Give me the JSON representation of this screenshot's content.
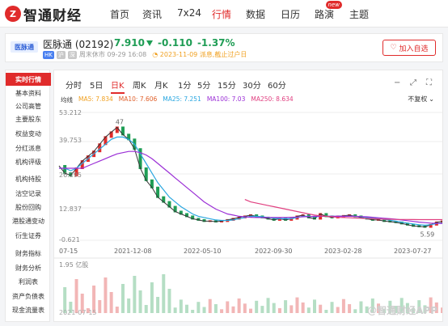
{
  "nav": {
    "logo_mark": "Z",
    "logo_text": "智通财经",
    "items": [
      {
        "label": "首页"
      },
      {
        "label": "资讯"
      },
      {
        "label": "7x24"
      },
      {
        "label": "行情"
      },
      {
        "label": "数据"
      },
      {
        "label": "日历"
      },
      {
        "label": "路演"
      },
      {
        "label": "主题"
      }
    ],
    "new_badge": "new",
    "active": "行情"
  },
  "stock": {
    "logo_text": "医脉通",
    "name": "医脉通 (02192)",
    "price": "7.910",
    "change": "-0.110",
    "change_pct": "-1.37%",
    "market_tag": "HK",
    "tag2": "沪",
    "tag3": "深",
    "status": "周末休市 09-29 16:08",
    "event": "2023-11-09 派息,截止过户日",
    "follow_label": "加入自选"
  },
  "sidebar": {
    "items": [
      {
        "label": "实时行情"
      },
      {
        "label": "基本资料"
      },
      {
        "label": "公司高管"
      },
      {
        "label": "主要股东"
      },
      {
        "label": "权益变动"
      },
      {
        "label": "分红派息"
      },
      {
        "label": "机构评级"
      },
      {
        "label": "机构持股"
      },
      {
        "label": "沽空记录"
      },
      {
        "label": "股份回购"
      },
      {
        "label": "港股通变动"
      },
      {
        "label": "衍生证券"
      },
      {
        "label": "财务指标"
      },
      {
        "label": "财务分析"
      },
      {
        "label": "利润表"
      },
      {
        "label": "资产负债表"
      },
      {
        "label": "现金流量表"
      }
    ]
  },
  "chart": {
    "tabs": [
      {
        "label": "分时"
      },
      {
        "label": "5日"
      },
      {
        "label": "日K"
      },
      {
        "label": "周K"
      },
      {
        "label": "月K"
      },
      {
        "label": "1分"
      },
      {
        "label": "5分"
      },
      {
        "label": "15分"
      },
      {
        "label": "30分"
      },
      {
        "label": "60分"
      }
    ],
    "active_tab": "日K",
    "ma_prefix": "均线",
    "ma": [
      {
        "label": "MA5: 7.834",
        "color": "#f0a020"
      },
      {
        "label": "MA10: 7.606",
        "color": "#e0602b"
      },
      {
        "label": "MA25: 7.251",
        "color": "#2aa7e0"
      },
      {
        "label": "MA100: 7.03",
        "color": "#9b2fd6"
      },
      {
        "label": "MA250: 8.634",
        "color": "#e04080"
      }
    ],
    "adjust_label": "不复权",
    "y_ticks": [
      "53.212",
      "39.753",
      "26.295",
      "12.837",
      "-0.621"
    ],
    "x_ticks": [
      "07-15",
      "2021-12-08",
      "2022-05-10",
      "2022-09-30",
      "2023-02-28",
      "2023-07-27"
    ],
    "high_marker": "47",
    "low_marker": "5.59",
    "volume_label": "1.95 亿股",
    "bottom_date": "2021-07-15",
    "watermark": "@智通财经APP"
  },
  "chart_data": {
    "type": "line",
    "title": "",
    "ylim": [
      -0.621,
      53.212
    ],
    "x_ticks": [
      "07-15",
      "2021-12-08",
      "2022-05-10",
      "2022-09-30",
      "2023-02-28",
      "2023-07-27"
    ],
    "series": [
      {
        "name": "",
        "color": "#333333",
        "values": [
          31,
          28,
          27,
          30,
          33,
          35,
          37,
          40,
          43,
          45,
          47,
          44,
          42,
          38,
          30,
          25,
          22,
          18,
          16,
          14,
          12,
          11,
          10,
          9,
          8.5,
          8,
          8,
          7.8,
          8,
          8.5,
          9,
          9.5,
          10,
          10.5,
          10,
          9.5,
          9,
          8.5,
          9,
          8.5,
          9,
          10,
          10.5,
          9.5,
          9,
          11,
          10,
          9.5,
          10,
          10.2,
          10.5,
          10,
          9.5,
          9,
          8.5,
          8.5,
          8,
          7.8,
          7.5,
          7,
          6.5,
          6,
          5.8,
          5.59,
          6.5,
          7.5,
          7.91
        ]
      },
      {
        "name": "MA25",
        "color": "#2aa7e0",
        "values": [
          30,
          30,
          29,
          30,
          32,
          34,
          36,
          38,
          40,
          42,
          43,
          43,
          42,
          40,
          36,
          32,
          28,
          24,
          21,
          18,
          16,
          14,
          12.5,
          11,
          10,
          9.5,
          9,
          8.5,
          8.3,
          8.3,
          8.5,
          9,
          9.5,
          10,
          10,
          9.8,
          9.5,
          9.2,
          9,
          9,
          9,
          9.5,
          10,
          10,
          9.8,
          10,
          10,
          10,
          10,
          10,
          10,
          10,
          9.8,
          9.5,
          9.2,
          9,
          8.7,
          8.4,
          8,
          7.6,
          7.2,
          6.8,
          6.5,
          6.3,
          6.5,
          7,
          7.25
        ]
      },
      {
        "name": "MA100",
        "color": "#9b2fd6",
        "values": [
          30,
          30,
          30,
          30,
          30,
          31,
          32,
          33,
          34,
          35,
          36,
          36.5,
          37,
          37,
          36.5,
          35.5,
          34,
          32,
          30,
          28,
          26,
          24,
          22,
          20,
          18,
          16,
          14.5,
          13,
          12,
          11,
          10.5,
          10,
          9.8,
          9.6,
          9.5,
          9.5,
          9.5,
          9.5,
          9.5,
          9.5,
          9.6,
          9.7,
          9.8,
          9.9,
          10,
          10,
          10,
          10,
          10,
          10,
          10,
          10,
          9.9,
          9.8,
          9.6,
          9.4,
          9.2,
          9,
          8.8,
          8.5,
          8.2,
          7.9,
          7.6,
          7.4,
          7.2,
          7.1,
          7.03
        ]
      },
      {
        "name": "MA250",
        "color": "#e04080",
        "values": [
          null,
          null,
          null,
          null,
          null,
          null,
          null,
          null,
          null,
          null,
          null,
          null,
          null,
          null,
          null,
          null,
          null,
          null,
          null,
          null,
          null,
          null,
          null,
          null,
          null,
          null,
          null,
          null,
          null,
          null,
          null,
          null,
          17,
          16,
          15.5,
          15,
          14.5,
          14,
          13.5,
          13,
          12.5,
          12,
          11.5,
          11,
          10.5,
          10.2,
          10,
          9.8,
          9.6,
          9.5,
          9.4,
          9.3,
          9.2,
          9.1,
          9,
          8.9,
          8.8,
          8.8,
          8.7,
          8.7,
          8.7,
          8.65,
          8.64,
          8.634,
          8.634,
          8.634,
          8.634
        ]
      }
    ]
  }
}
